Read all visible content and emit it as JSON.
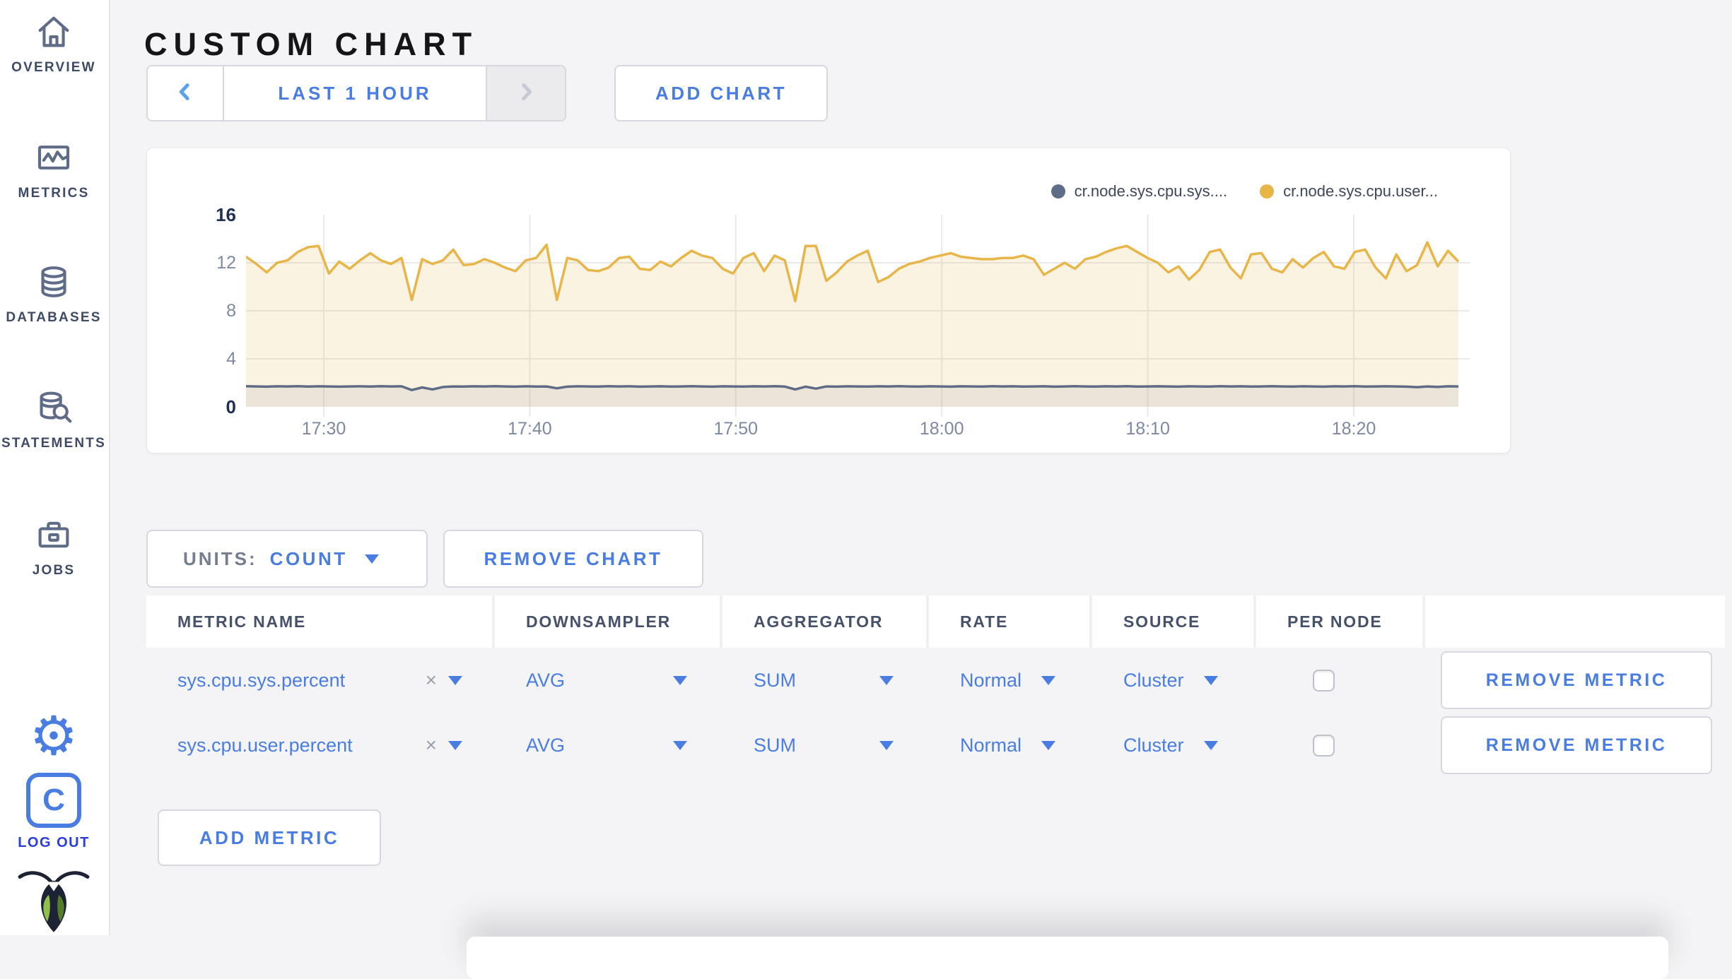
{
  "sidebar": {
    "items": [
      {
        "label": "OVERVIEW",
        "icon": "home-icon"
      },
      {
        "label": "METRICS",
        "icon": "metrics-icon"
      },
      {
        "label": "DATABASES",
        "icon": "database-icon"
      },
      {
        "label": "STATEMENTS",
        "icon": "statements-icon"
      },
      {
        "label": "JOBS",
        "icon": "briefcase-icon"
      }
    ],
    "logo_letter": "C",
    "logout_label": "LOG OUT"
  },
  "header": {
    "title": "CUSTOM CHART",
    "time_range_label": "LAST 1 HOUR",
    "add_chart_label": "ADD CHART"
  },
  "controls": {
    "units_label": "UNITS:",
    "units_value": "COUNT",
    "remove_chart_label": "REMOVE CHART",
    "add_metric_label": "ADD METRIC"
  },
  "table": {
    "headers": [
      "METRIC NAME",
      "DOWNSAMPLER",
      "AGGREGATOR",
      "RATE",
      "SOURCE",
      "PER NODE"
    ],
    "remove_icon": "×",
    "rows": [
      {
        "metric": "sys.cpu.sys.percent",
        "downsampler": "AVG",
        "aggregator": "SUM",
        "rate": "Normal",
        "source": "Cluster",
        "per_node": false,
        "remove_label": "REMOVE METRIC"
      },
      {
        "metric": "sys.cpu.user.percent",
        "downsampler": "AVG",
        "aggregator": "SUM",
        "rate": "Normal",
        "source": "Cluster",
        "per_node": false,
        "remove_label": "REMOVE METRIC"
      }
    ]
  },
  "chart_data": {
    "type": "line",
    "title": "",
    "xlabel": "",
    "ylabel": "",
    "x_ticks": [
      "17:30",
      "17:40",
      "17:50",
      "18:00",
      "18:10",
      "18:20"
    ],
    "y_ticks": [
      0,
      4,
      8,
      12,
      16
    ],
    "ylim": [
      0,
      16
    ],
    "x_range": [
      "17:26",
      "18:25"
    ],
    "point_interval_seconds": 30,
    "grid": true,
    "legend_position": "top-right",
    "legend": [
      {
        "name": "cr.node.sys.cpu.sys....",
        "color": "#5F6C87"
      },
      {
        "name": "cr.node.sys.cpu.user...",
        "color": "#E7B548"
      }
    ],
    "series": [
      {
        "name": "cr.node.sys.cpu.sys....",
        "color": "#5F6C87",
        "fill": "rgba(95,108,135,0.10)",
        "values": [
          1.72,
          1.7,
          1.68,
          1.71,
          1.7,
          1.72,
          1.69,
          1.71,
          1.7,
          1.68,
          1.7,
          1.71,
          1.69,
          1.72,
          1.7,
          1.71,
          1.4,
          1.62,
          1.45,
          1.65,
          1.7,
          1.69,
          1.71,
          1.7,
          1.72,
          1.7,
          1.68,
          1.71,
          1.69,
          1.7,
          1.55,
          1.68,
          1.71,
          1.7,
          1.69,
          1.72,
          1.7,
          1.71,
          1.68,
          1.7,
          1.71,
          1.69,
          1.7,
          1.72,
          1.7,
          1.68,
          1.71,
          1.7,
          1.69,
          1.71,
          1.7,
          1.72,
          1.69,
          1.45,
          1.68,
          1.52,
          1.7,
          1.68,
          1.71,
          1.7,
          1.69,
          1.71,
          1.7,
          1.72,
          1.7,
          1.69,
          1.71,
          1.7,
          1.68,
          1.71,
          1.7,
          1.69,
          1.72,
          1.7,
          1.71,
          1.69,
          1.7,
          1.71,
          1.68,
          1.7,
          1.72,
          1.7,
          1.69,
          1.71,
          1.7,
          1.72,
          1.69,
          1.7,
          1.71,
          1.7,
          1.68,
          1.71,
          1.7,
          1.69,
          1.72,
          1.7,
          1.71,
          1.69,
          1.7,
          1.72,
          1.7,
          1.69,
          1.71,
          1.7,
          1.68,
          1.71,
          1.7,
          1.72,
          1.69,
          1.7,
          1.71,
          1.7,
          1.68,
          1.64,
          1.7,
          1.66,
          1.71,
          1.7
        ]
      },
      {
        "name": "cr.node.sys.cpu.user...",
        "color": "#E7B548",
        "fill": "rgba(231,181,72,0.16)",
        "values": [
          12.5,
          11.9,
          11.2,
          12.0,
          12.2,
          12.9,
          13.3,
          13.4,
          11.1,
          12.1,
          11.5,
          12.2,
          12.8,
          12.2,
          11.9,
          12.4,
          8.9,
          12.3,
          11.9,
          12.2,
          13.1,
          11.8,
          11.9,
          12.3,
          12.0,
          11.6,
          11.3,
          12.2,
          12.4,
          13.5,
          8.9,
          12.4,
          12.2,
          11.4,
          11.3,
          11.6,
          12.4,
          12.5,
          11.5,
          11.4,
          12.1,
          11.7,
          12.4,
          13.0,
          12.6,
          12.4,
          11.5,
          11.1,
          12.4,
          12.8,
          11.3,
          12.6,
          12.2,
          8.8,
          13.4,
          13.4,
          10.5,
          11.2,
          12.1,
          12.6,
          13.0,
          10.4,
          10.8,
          11.5,
          11.9,
          12.1,
          12.4,
          12.6,
          12.8,
          12.5,
          12.4,
          12.3,
          12.3,
          12.4,
          12.4,
          12.6,
          12.3,
          11.0,
          11.5,
          12.0,
          11.5,
          12.3,
          12.5,
          12.9,
          13.2,
          13.4,
          12.9,
          12.4,
          12.0,
          11.2,
          11.7,
          10.6,
          11.4,
          12.9,
          13.1,
          11.6,
          10.7,
          12.7,
          12.8,
          11.5,
          11.2,
          12.3,
          11.6,
          12.4,
          12.9,
          11.7,
          11.5,
          12.9,
          13.1,
          11.6,
          10.7,
          12.7,
          11.3,
          11.8,
          13.7,
          11.7,
          13.0,
          12.1
        ]
      }
    ]
  },
  "colors": {
    "accent_blue": "#4a7de2",
    "light_blue_chevron": "#5ba3e9",
    "disabled_chevron": "#c7cad2",
    "series_yellow": "#E7B548",
    "series_slate": "#5F6C87",
    "grid": "#e9e9ec",
    "page_bg": "#f4f4f6",
    "logout_blue": "#2b3cd8"
  }
}
